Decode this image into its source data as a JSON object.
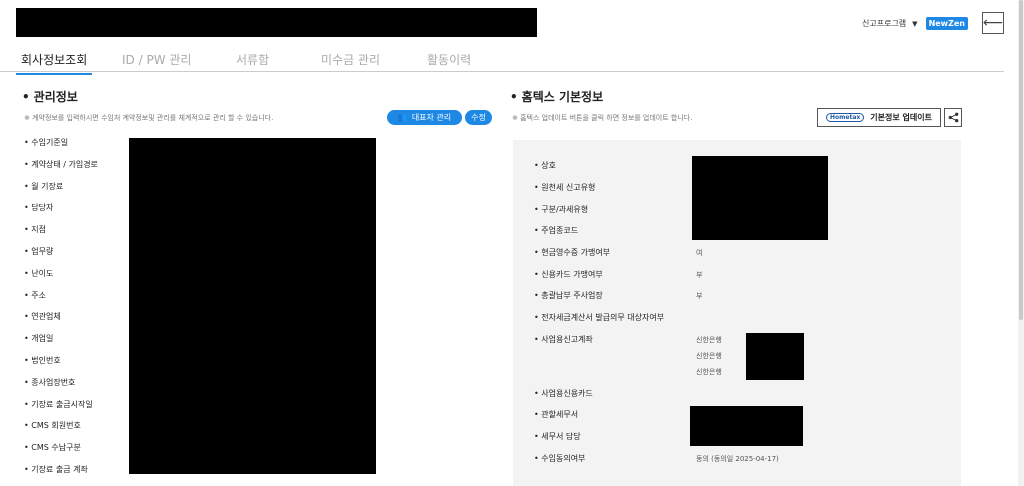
{
  "header": {
    "menu_label": "신고프로그램",
    "brand_badge": "NewZen",
    "back_icon": "arrow-left-icon"
  },
  "tabs": [
    {
      "label": "회사정보조회",
      "active": true
    },
    {
      "label": "ID / PW 관리",
      "active": false
    },
    {
      "label": "서류함",
      "active": false
    },
    {
      "label": "미수금 관리",
      "active": false
    },
    {
      "label": "활동이력",
      "active": false
    }
  ],
  "management": {
    "title": "관리정보",
    "note": "※ 계약정보를 입력하시면 수임처 계약정보및 관리를 체계적으로 관리 할 수 있습니다.",
    "rep_manage_label": "대표자 관리",
    "edit_label": "수정",
    "fields": [
      "수임기준일",
      "계약상태 / 가입경로",
      "월 기장료",
      "담당자",
      "지점",
      "업무량",
      "난이도",
      "주소",
      "연관업체",
      "개업일",
      "법인번호",
      "종사업장번호",
      "기장료 출금시작일",
      "CMS 회원번호",
      "CMS 수납구분",
      "기장료 출금 계좌"
    ]
  },
  "hometax": {
    "title": "홈텍스 기본정보",
    "note": "※ 홈텍스 업데이트 버튼을 클릭 하면 정보를 업데이트 합니다.",
    "logo_text": "Hometax",
    "update_label": "기본정보 업데이트",
    "rows": [
      {
        "label": "상호",
        "value": ""
      },
      {
        "label": "원천세 신고유형",
        "value": ""
      },
      {
        "label": "구분/과세유형",
        "value": ""
      },
      {
        "label": "주업종코드",
        "value": ""
      },
      {
        "label": "현금영수증 가맹여부",
        "value": "여"
      },
      {
        "label": "신용카드 가맹여부",
        "value": "부"
      },
      {
        "label": "총괄납부 주사업장",
        "value": "부"
      },
      {
        "label": "전자세금계산서 발급의무 대상자여부",
        "value": ""
      },
      {
        "label": "사업용신고계좌",
        "value": ""
      },
      {
        "label": "사업용신용카드",
        "value": ""
      },
      {
        "label": "관할세무서",
        "value": ""
      },
      {
        "label": "세무서 담당",
        "value": ""
      },
      {
        "label": "수임동의여부",
        "value": "동의 (동의일 2025-04-17)"
      }
    ],
    "bank_accounts": [
      "신한은행",
      "신한은행",
      "신한은행"
    ]
  }
}
